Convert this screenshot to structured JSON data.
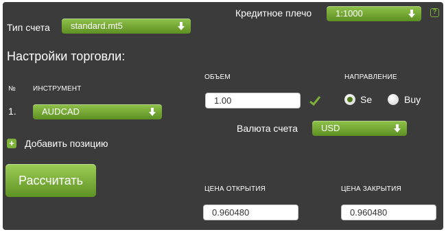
{
  "colors": {
    "panel_bg": "#3b3b3b",
    "accent_green": "#6fa12e",
    "text": "#ffffff"
  },
  "header": {
    "leverage_label": "Кредитное плечо",
    "leverage_value": "1:1000",
    "help_icon_text": "?"
  },
  "account": {
    "type_label": "Тип счета",
    "type_value": "standard.mt5"
  },
  "settings": {
    "title": "Настройки торговли:",
    "col_no": "№",
    "col_instrument": "ИНСТРУМЕНТ",
    "col_volume": "ОБЪЕМ",
    "col_direction": "НАПРАВЛЕНИЕ"
  },
  "position": {
    "number": "1.",
    "instrument": "AUDCAD",
    "volume": "1.00",
    "sell_label": "Se",
    "buy_label": "Buy",
    "selected_direction": "sell"
  },
  "currency": {
    "label": "Валюта счета",
    "value": "USD"
  },
  "add_position": {
    "icon_text": "+",
    "label": "Добавить позицию"
  },
  "calculate_label": "Рассчитать",
  "prices": {
    "open_label": "ЦЕНА ОТКРЫТИЯ",
    "open_value": "0.960480",
    "close_label": "ЦЕНА ЗАКРЫТИЯ",
    "close_value": "0.960480"
  }
}
